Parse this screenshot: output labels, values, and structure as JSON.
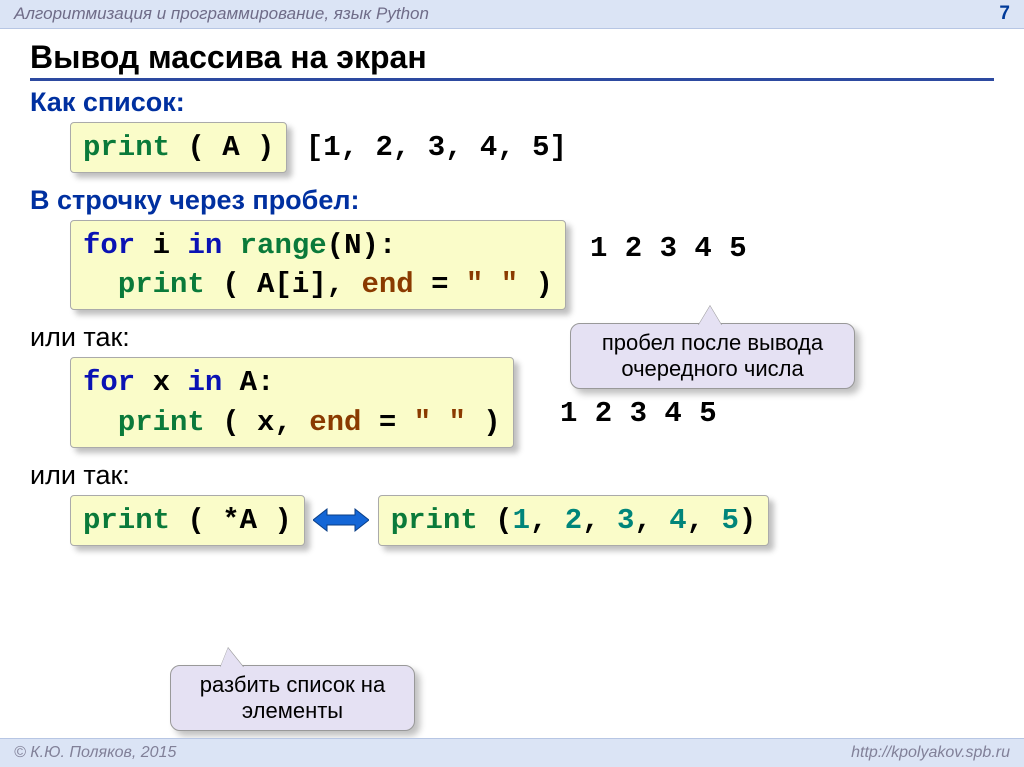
{
  "header": {
    "course": "Алгоритмизация и программирование, язык Python",
    "page": "7"
  },
  "title": "Вывод массива на экран",
  "sections": {
    "as_list": {
      "heading": "Как список:",
      "code_tokens": {
        "print": "print",
        "rest": " ( A )"
      },
      "output": "[1, 2, 3, 4, 5]"
    },
    "as_row_space": {
      "heading": "В строчку через пробел:",
      "code": {
        "for_kw": "for",
        "sp1": " i ",
        "in_kw": "in",
        "sp2": " ",
        "range_fn": "range",
        "range_arg": "(N):",
        "line2_indent": "  ",
        "print_fn": "print",
        "print_args_a": " ( A[i], ",
        "end_id": "end",
        "eq": " = ",
        "str": "\" \"",
        "close": " )"
      },
      "output": "1 2 3 4 5",
      "callout": "пробел после вывода очередного числа"
    },
    "or1": {
      "heading": "или так:",
      "code": {
        "for_kw": "for",
        "sp1": " x ",
        "in_kw": "in",
        "rest1": " A:",
        "line2_indent": "  ",
        "print_fn": "print",
        "print_args_a": " ( x, ",
        "end_id": "end",
        "eq": " = ",
        "str": "\" \"",
        "close": " )"
      },
      "output": "1 2 3 4 5"
    },
    "or2": {
      "heading": "или так:",
      "left_code": {
        "print_fn": "print",
        "rest": " ( *A )"
      },
      "right_code": {
        "print_fn": "print",
        "open": " (",
        "n1": "1",
        "c1": ", ",
        "n2": "2",
        "c2": ", ",
        "n3": "3",
        "c3": ", ",
        "n4": "4",
        "c4": ", ",
        "n5": "5",
        "close": ")"
      },
      "callout": "разбить список на элементы"
    }
  },
  "footer": {
    "copyright": "© К.Ю. Поляков, 2015",
    "url": "http://kpolyakov.spb.ru"
  }
}
